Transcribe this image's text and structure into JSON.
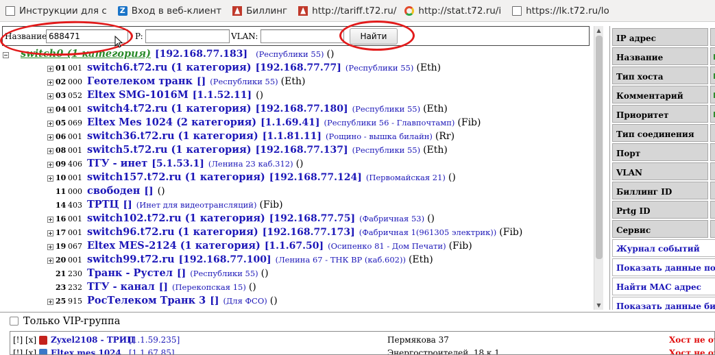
{
  "bookmarks": [
    {
      "label": "Инструкции для с",
      "icon": "doc-icon"
    },
    {
      "label": "Вход в веб-клиент",
      "icon": "zimbra-icon"
    },
    {
      "label": "Биллинг",
      "icon": "billing-icon"
    },
    {
      "label": "http://tariff.t72.ru/",
      "icon": "billing-icon"
    },
    {
      "label": "http://stat.t72.ru/i",
      "icon": "stat-icon"
    },
    {
      "label": "https://lk.t72.ru/lo",
      "icon": "doc-icon"
    }
  ],
  "search": {
    "name_label": "Название:",
    "name_value": "688471",
    "ip_label": "P:",
    "ip_value": "",
    "vlan_label": "VLAN:",
    "vlan_value": "",
    "button": "Найти"
  },
  "tree": {
    "root": {
      "name": "switch0 (1 категория)",
      "ip": "[192.168.77.183]",
      "loc": "(Республики 55)",
      "extra": "()"
    },
    "rows": [
      {
        "num": "01",
        "code": "001",
        "name": "switch6.t72.ru (1 категория)",
        "ip": "[192.168.77.77]",
        "loc": "(Республики 55)",
        "extra": "(Eth)",
        "exp": true
      },
      {
        "num": "02",
        "code": "000",
        "name": "Геотелеком транк",
        "ip": "[]",
        "loc": "(Республики 55)",
        "extra": "(Eth)",
        "exp": true
      },
      {
        "num": "03",
        "code": "052",
        "name": "Eltex SMG-1016M",
        "ip": "[1.1.52.11]",
        "loc": "",
        "extra": "()",
        "exp": true
      },
      {
        "num": "04",
        "code": "001",
        "name": "switch4.t72.ru (1 категория)",
        "ip": "[192.168.77.180]",
        "loc": "(Республики 55)",
        "extra": "(Eth)",
        "exp": true
      },
      {
        "num": "05",
        "code": "069",
        "name": "Eltex Mes 1024 (2 категория)",
        "ip": "[1.1.69.41]",
        "loc": "(Республики 56 - Главпочтамп)",
        "extra": "(Fib)",
        "exp": true
      },
      {
        "num": "06",
        "code": "001",
        "name": "switch36.t72.ru (1 категория)",
        "ip": "[1.1.81.11]",
        "loc": "(Рощино - вышка билайн)",
        "extra": "(Rr)",
        "exp": true
      },
      {
        "num": "08",
        "code": "001",
        "name": "switch5.t72.ru (1 категория)",
        "ip": "[192.168.77.137]",
        "loc": "(Республики 55)",
        "extra": "(Eth)",
        "exp": true
      },
      {
        "num": "09",
        "code": "406",
        "name": "ТГУ - инет",
        "ip": "[5.1.53.1]",
        "loc": "(Ленина 23 каб.312)",
        "extra": "()",
        "exp": true
      },
      {
        "num": "10",
        "code": "001",
        "name": "switch157.t72.ru (1 категория)",
        "ip": "[192.168.77.124]",
        "loc": "(Первомайская 21)",
        "extra": "()",
        "exp": true
      },
      {
        "num": "11",
        "code": "000",
        "name": "свободен",
        "ip": "[]",
        "loc": "",
        "extra": "()",
        "exp": false
      },
      {
        "num": "14",
        "code": "403",
        "name": "ТРТЦ",
        "ip": "[]",
        "loc": "(Инет для видеотрансляций)",
        "extra": "(Fib)",
        "exp": false
      },
      {
        "num": "16",
        "code": "001",
        "name": "switch102.t72.ru (1 категория)",
        "ip": "[192.168.77.75]",
        "loc": "(Фабричная 53)",
        "extra": "()",
        "exp": true
      },
      {
        "num": "17",
        "code": "001",
        "name": "switch96.t72.ru (1 категория)",
        "ip": "[192.168.77.173]",
        "loc": "(Фабричная 1(961305 электрик))",
        "extra": "(Fib)",
        "exp": true
      },
      {
        "num": "19",
        "code": "067",
        "name": "Eltex MES-2124 (1 категория)",
        "ip": "[1.1.67.50]",
        "loc": "(Осипенко 81 - Дом Печати)",
        "extra": "(Fib)",
        "exp": true
      },
      {
        "num": "20",
        "code": "001",
        "name": "switch99.t72.ru",
        "ip": "[192.168.77.100]",
        "loc": "(Ленина 67 - ТНК ВР (каб.602))",
        "extra": "(Eth)",
        "exp": true
      },
      {
        "num": "21",
        "code": "230",
        "name": "Транк - Рустел",
        "ip": "[]",
        "loc": "(Республики 55)",
        "extra": "()",
        "exp": false
      },
      {
        "num": "23",
        "code": "232",
        "name": "ТГУ - канал",
        "ip": "[]",
        "loc": "(Перекопская 15)",
        "extra": "()",
        "exp": false
      },
      {
        "num": "25",
        "code": "915",
        "name": "РосТелеком Транк 3",
        "ip": "[]",
        "loc": "(Для ФСО)",
        "extra": "()",
        "exp": true
      }
    ]
  },
  "props": [
    {
      "label": "IP адрес",
      "val_color": ""
    },
    {
      "label": "Название",
      "val_color": "#2e8b2e"
    },
    {
      "label": "Тип хоста",
      "val_color": "#2e8b2e"
    },
    {
      "label": "Комментарий",
      "val_color": "#2e8b2e"
    },
    {
      "label": "Приоритет",
      "val_color": "#2e8b2e"
    },
    {
      "label": "Тип соединения",
      "val_color": ""
    },
    {
      "label": "Порт",
      "val_color": ""
    },
    {
      "label": "VLAN",
      "val_color": ""
    },
    {
      "label": "Биллинг ID",
      "val_color": ""
    },
    {
      "label": "Prtg ID",
      "val_color": ""
    },
    {
      "label": "Сервис",
      "val_color": ""
    }
  ],
  "actions": [
    "Журнал событий",
    "Показать данные порта",
    "Найти MAC адрес",
    "Показать данные биллин"
  ],
  "vip": {
    "label": "Только VIP-группа"
  },
  "hosts": [
    {
      "flags": "[!] [x]",
      "name": "Zyxel2108 - ТРИЦ",
      "ip": "[1.1.59.235]",
      "addr": "Пермякова 37",
      "status": "Хост не отв",
      "icon": "red"
    },
    {
      "flags": "[!] [x]",
      "name": "Eltex mes 1024",
      "ip": "[1.1.67.85]",
      "addr": "Энергостроителей, 18 к.1",
      "status": "Хост не отв",
      "icon": "blue"
    }
  ]
}
